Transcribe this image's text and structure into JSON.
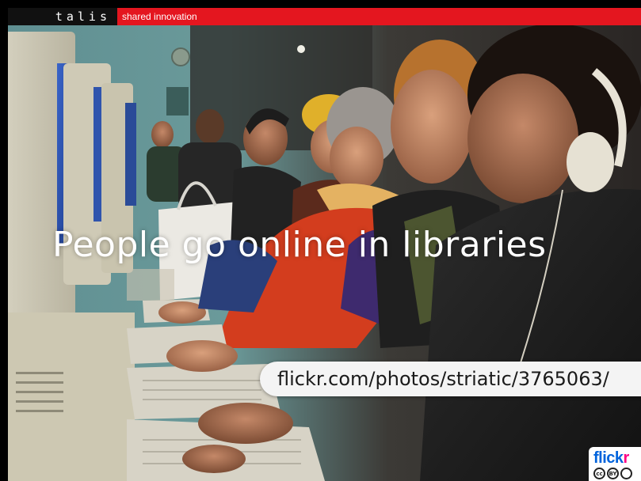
{
  "header": {
    "brand": "talis",
    "tagline": "shared innovation",
    "brand_color": "#111111",
    "band_color": "#e4161f"
  },
  "slide": {
    "headline": "People go online in libraries",
    "photo_credit": "flickr.com/photos/striatic/3765063/"
  },
  "badge": {
    "flickr_blue": "flick",
    "flickr_pink": "r",
    "cc_icon": "cc-icon",
    "by_icon": "by-icon",
    "cc_label": "cc",
    "by_label": "BY"
  }
}
